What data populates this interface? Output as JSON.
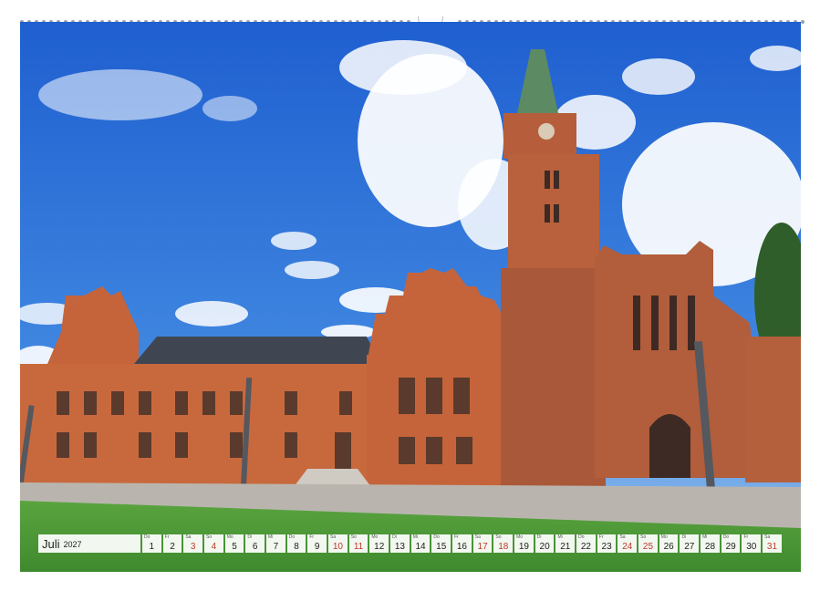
{
  "calendar": {
    "month": "Juli",
    "year": "2027",
    "days": [
      {
        "wd": "Do",
        "num": "1",
        "weekend": false
      },
      {
        "wd": "Fr",
        "num": "2",
        "weekend": false
      },
      {
        "wd": "Sa",
        "num": "3",
        "weekend": true
      },
      {
        "wd": "So",
        "num": "4",
        "weekend": true
      },
      {
        "wd": "Mo",
        "num": "5",
        "weekend": false
      },
      {
        "wd": "Di",
        "num": "6",
        "weekend": false
      },
      {
        "wd": "Mi",
        "num": "7",
        "weekend": false
      },
      {
        "wd": "Do",
        "num": "8",
        "weekend": false
      },
      {
        "wd": "Fr",
        "num": "9",
        "weekend": false
      },
      {
        "wd": "Sa",
        "num": "10",
        "weekend": true
      },
      {
        "wd": "So",
        "num": "11",
        "weekend": true
      },
      {
        "wd": "Mo",
        "num": "12",
        "weekend": false
      },
      {
        "wd": "Di",
        "num": "13",
        "weekend": false
      },
      {
        "wd": "Mi",
        "num": "14",
        "weekend": false
      },
      {
        "wd": "Do",
        "num": "15",
        "weekend": false
      },
      {
        "wd": "Fr",
        "num": "16",
        "weekend": false
      },
      {
        "wd": "Sa",
        "num": "17",
        "weekend": true
      },
      {
        "wd": "So",
        "num": "18",
        "weekend": true
      },
      {
        "wd": "Mo",
        "num": "19",
        "weekend": false
      },
      {
        "wd": "Di",
        "num": "20",
        "weekend": false
      },
      {
        "wd": "Mi",
        "num": "21",
        "weekend": false
      },
      {
        "wd": "Do",
        "num": "22",
        "weekend": false
      },
      {
        "wd": "Fr",
        "num": "23",
        "weekend": false
      },
      {
        "wd": "Sa",
        "num": "24",
        "weekend": true
      },
      {
        "wd": "So",
        "num": "25",
        "weekend": true
      },
      {
        "wd": "Mo",
        "num": "26",
        "weekend": false
      },
      {
        "wd": "Di",
        "num": "27",
        "weekend": false
      },
      {
        "wd": "Mi",
        "num": "28",
        "weekend": false
      },
      {
        "wd": "Do",
        "num": "29",
        "weekend": false
      },
      {
        "wd": "Fr",
        "num": "30",
        "weekend": false
      },
      {
        "wd": "Sa",
        "num": "31",
        "weekend": true
      }
    ]
  },
  "colors": {
    "sky": "#2f74d6",
    "brick": "#c8693d",
    "weekend": "#c0392b",
    "grass": "#4f9a3a"
  }
}
